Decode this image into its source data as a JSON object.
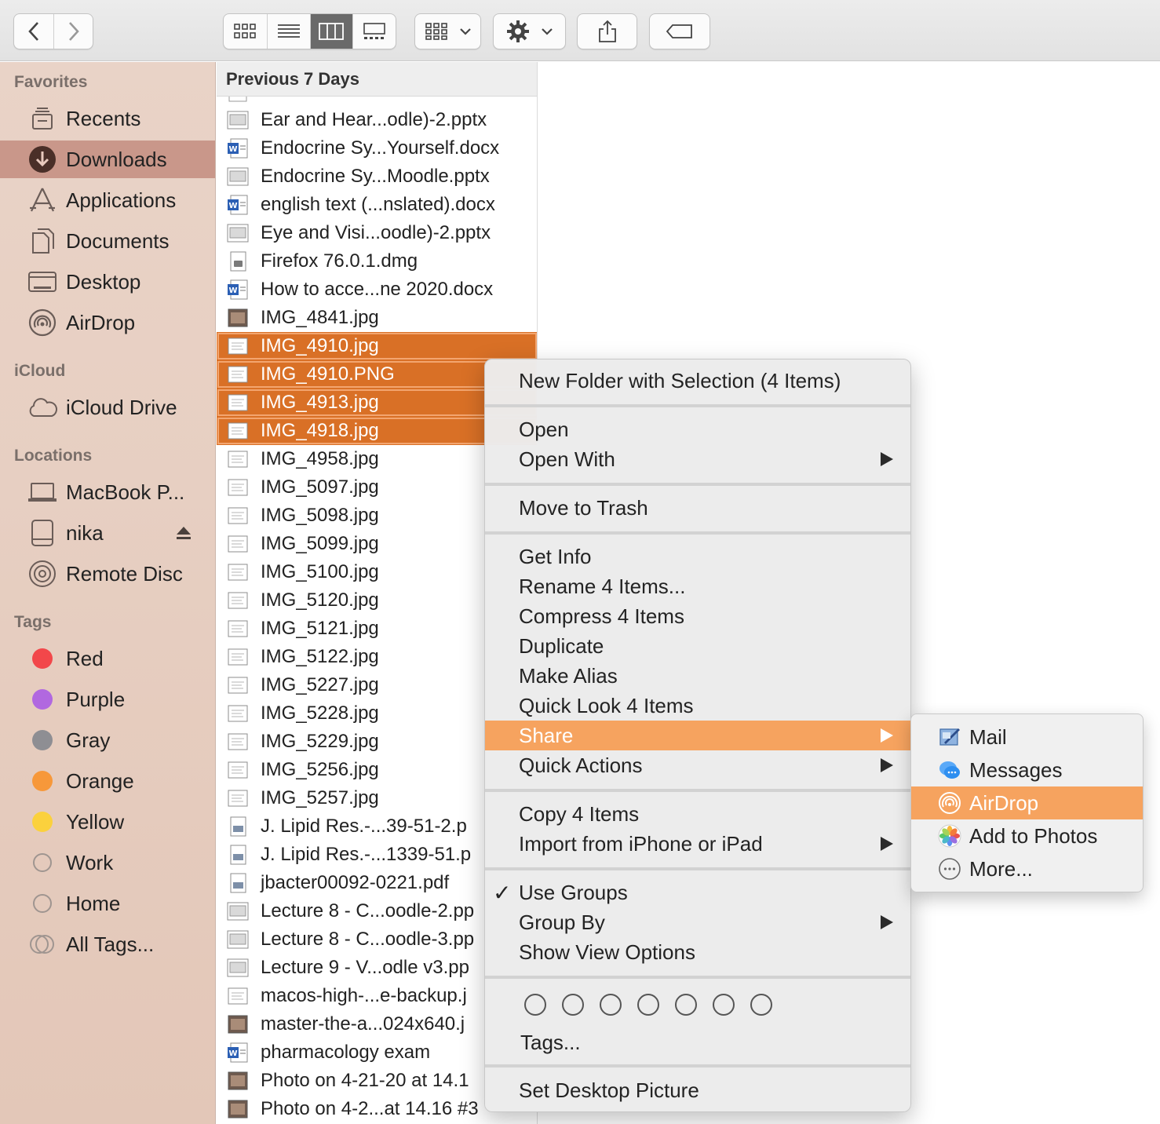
{
  "toolbar": {
    "back_icon": "chevron-left-icon",
    "forward_icon": "chevron-right-icon",
    "view_modes": [
      "icon-view",
      "list-view",
      "column-view",
      "gallery-view"
    ],
    "active_view": "column-view"
  },
  "sidebar": {
    "favorites_title": "Favorites",
    "favorites": [
      {
        "label": "Recents",
        "icon": "recents-icon"
      },
      {
        "label": "Downloads",
        "icon": "downloads-icon",
        "selected": true
      },
      {
        "label": "Applications",
        "icon": "applications-icon"
      },
      {
        "label": "Documents",
        "icon": "documents-icon"
      },
      {
        "label": "Desktop",
        "icon": "desktop-icon"
      },
      {
        "label": "AirDrop",
        "icon": "airdrop-icon"
      }
    ],
    "icloud_title": "iCloud",
    "icloud": [
      {
        "label": "iCloud Drive",
        "icon": "cloud-icon"
      }
    ],
    "locations_title": "Locations",
    "locations": [
      {
        "label": "MacBook P...",
        "icon": "laptop-icon"
      },
      {
        "label": "nika",
        "icon": "drive-icon"
      },
      {
        "label": "Remote Disc",
        "icon": "disc-icon"
      }
    ],
    "tags_title": "Tags",
    "tags": [
      {
        "label": "Red",
        "color": "#f2474a"
      },
      {
        "label": "Purple",
        "color": "#b168e0"
      },
      {
        "label": "Gray",
        "color": "#8e8e93"
      },
      {
        "label": "Orange",
        "color": "#f7983a"
      },
      {
        "label": "Yellow",
        "color": "#fbd13d"
      },
      {
        "label": "Work",
        "color": ""
      },
      {
        "label": "Home",
        "color": ""
      },
      {
        "label": "All Tags...",
        "color": ""
      }
    ]
  },
  "column": {
    "header": "Previous 7 Days",
    "files": [
      {
        "name": "Ear and Hear...odle)-2.pptx",
        "type": "pptx"
      },
      {
        "name": "Endocrine Sy...Yourself.docx",
        "type": "docx"
      },
      {
        "name": "Endocrine Sy...Moodle.pptx",
        "type": "pptx"
      },
      {
        "name": "english text (...nslated).docx",
        "type": "docx"
      },
      {
        "name": "Eye and Visi...oodle)-2.pptx",
        "type": "pptx"
      },
      {
        "name": "Firefox 76.0.1.dmg",
        "type": "dmg"
      },
      {
        "name": "How to acce...ne 2020.docx",
        "type": "docx"
      },
      {
        "name": "IMG_4841.jpg",
        "type": "photo"
      },
      {
        "name": "IMG_4910.jpg",
        "type": "image",
        "selected": true
      },
      {
        "name": "IMG_4910.PNG",
        "type": "image",
        "selected": true
      },
      {
        "name": "IMG_4913.jpg",
        "type": "image",
        "selected": true
      },
      {
        "name": "IMG_4918.jpg",
        "type": "image",
        "selected": true
      },
      {
        "name": "IMG_4958.jpg",
        "type": "image"
      },
      {
        "name": "IMG_5097.jpg",
        "type": "image"
      },
      {
        "name": "IMG_5098.jpg",
        "type": "image"
      },
      {
        "name": "IMG_5099.jpg",
        "type": "image"
      },
      {
        "name": "IMG_5100.jpg",
        "type": "image"
      },
      {
        "name": "IMG_5120.jpg",
        "type": "image"
      },
      {
        "name": "IMG_5121.jpg",
        "type": "image"
      },
      {
        "name": "IMG_5122.jpg",
        "type": "image"
      },
      {
        "name": "IMG_5227.jpg",
        "type": "image"
      },
      {
        "name": "IMG_5228.jpg",
        "type": "image"
      },
      {
        "name": "IMG_5229.jpg",
        "type": "image"
      },
      {
        "name": "IMG_5256.jpg",
        "type": "image"
      },
      {
        "name": "IMG_5257.jpg",
        "type": "image"
      },
      {
        "name": "J. Lipid Res.-...39-51-2.p",
        "type": "pdf"
      },
      {
        "name": "J. Lipid Res.-...1339-51.p",
        "type": "pdf"
      },
      {
        "name": "jbacter00092-0221.pdf",
        "type": "pdf"
      },
      {
        "name": "Lecture 8 - C...oodle-2.pp",
        "type": "pptx"
      },
      {
        "name": "Lecture 8 - C...oodle-3.pp",
        "type": "pptx"
      },
      {
        "name": "Lecture 9 - V...odle v3.pp",
        "type": "pptx"
      },
      {
        "name": "macos-high-...e-backup.j",
        "type": "image"
      },
      {
        "name": "master-the-a...024x640.j",
        "type": "photo"
      },
      {
        "name": "pharmacology exam",
        "type": "docx"
      },
      {
        "name": "Photo on 4-21-20 at 14.1",
        "type": "photo"
      },
      {
        "name": "Photo on 4-2...at 14.16 #3",
        "type": "photo"
      }
    ]
  },
  "context_menu": {
    "new_folder": "New Folder with Selection (4 Items)",
    "open": "Open",
    "open_with": "Open With",
    "move_to_trash": "Move to Trash",
    "get_info": "Get Info",
    "rename": "Rename 4 Items...",
    "compress": "Compress 4 Items",
    "duplicate": "Duplicate",
    "make_alias": "Make Alias",
    "quick_look": "Quick Look 4 Items",
    "share": "Share",
    "quick_actions": "Quick Actions",
    "copy": "Copy 4 Items",
    "import": "Import from iPhone or iPad",
    "use_groups_check": "✓",
    "use_groups": "Use Groups",
    "group_by": "Group By",
    "show_view_options": "Show View Options",
    "tags": "Tags...",
    "set_desktop": "Set Desktop Picture"
  },
  "share_menu": {
    "items": [
      {
        "label": "Mail",
        "icon": "mail-icon"
      },
      {
        "label": "Messages",
        "icon": "messages-icon"
      },
      {
        "label": "AirDrop",
        "icon": "airdrop-icon",
        "highlighted": true
      },
      {
        "label": "Add to Photos",
        "icon": "photos-icon"
      },
      {
        "label": "More...",
        "icon": "more-icon"
      }
    ]
  },
  "colors": {
    "selection": "#d97026",
    "menu_highlight": "#f6a35f",
    "sidebar_selected": "#c9978a"
  }
}
